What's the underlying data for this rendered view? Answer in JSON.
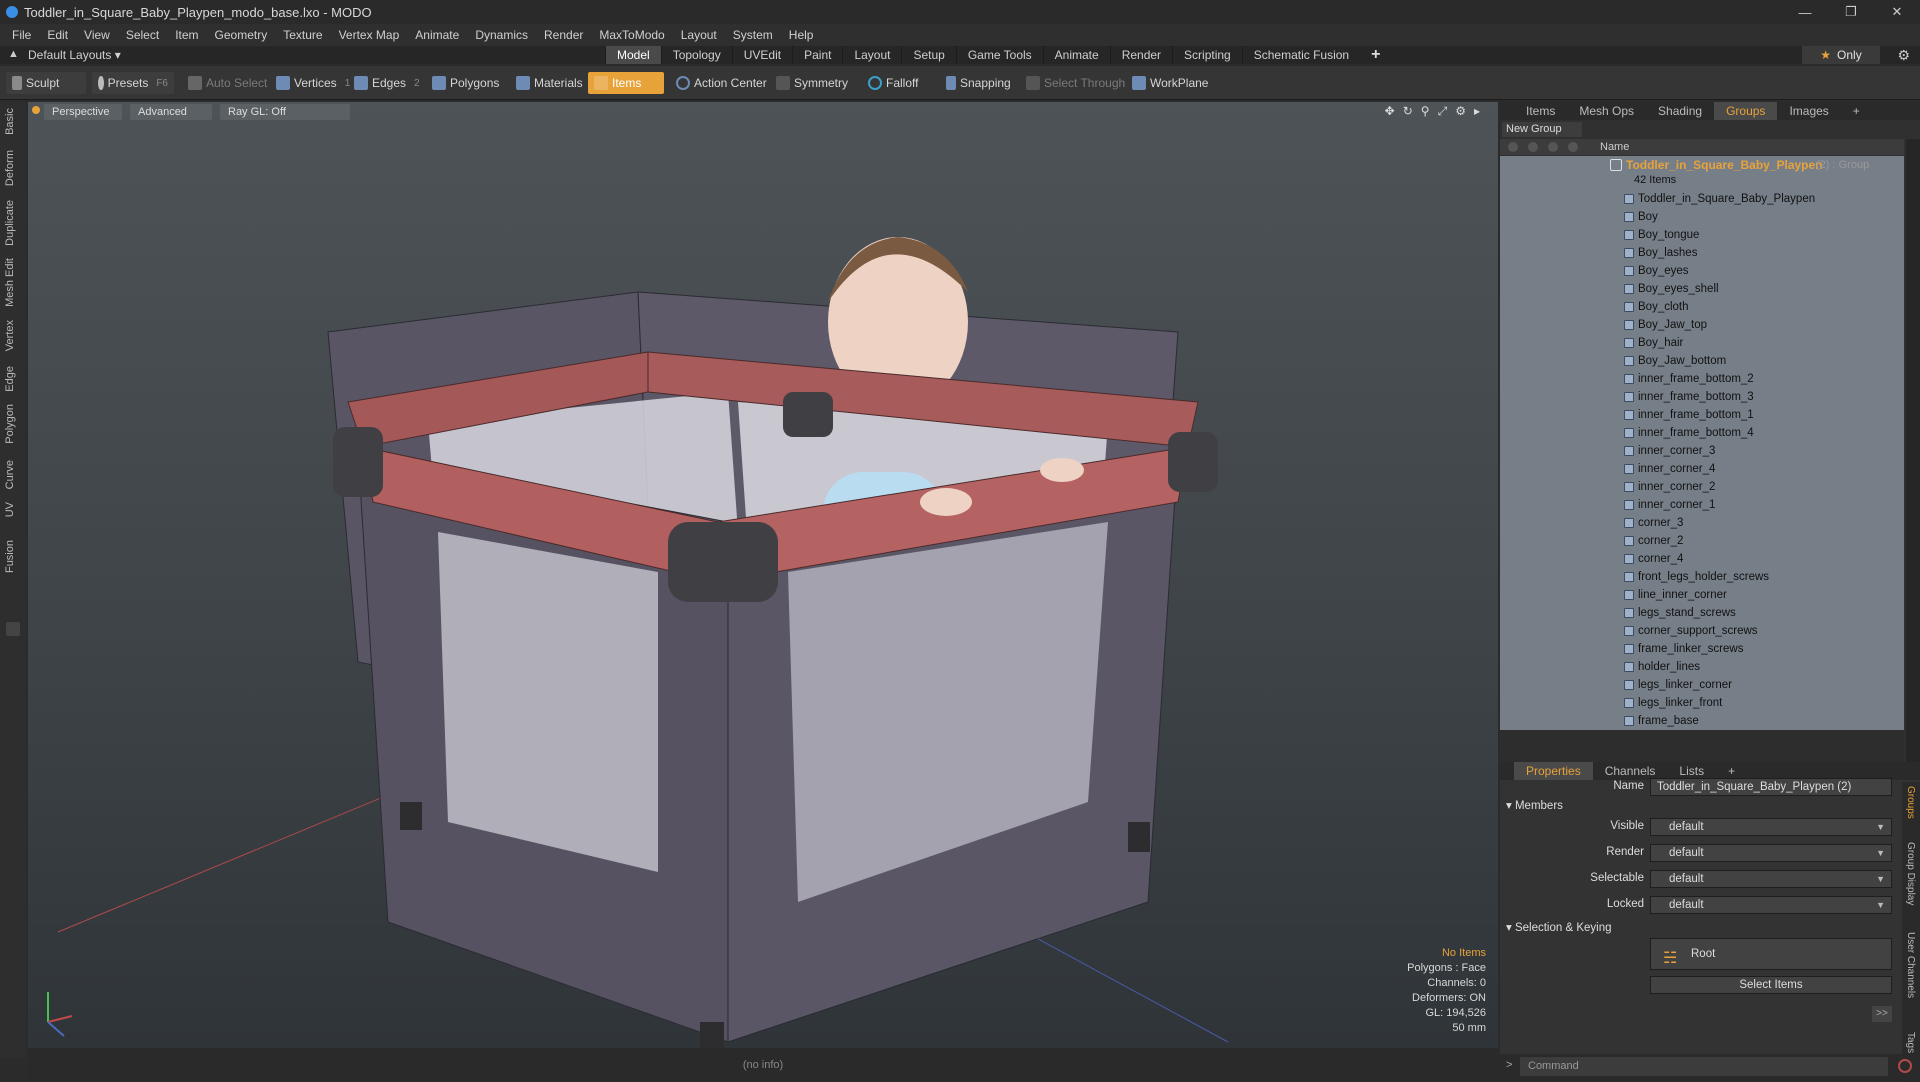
{
  "window": {
    "title": "Toddler_in_Square_Baby_Playpen_modo_base.lxo - MODO"
  },
  "menu": [
    "File",
    "Edit",
    "View",
    "Select",
    "Item",
    "Geometry",
    "Texture",
    "Vertex Map",
    "Animate",
    "Dynamics",
    "Render",
    "MaxToModo",
    "Layout",
    "System",
    "Help"
  ],
  "layout": {
    "dropdown": "Default Layouts ▾",
    "tabs": [
      "Model",
      "Topology",
      "UVEdit",
      "Paint",
      "Layout",
      "Setup",
      "Game Tools",
      "Animate",
      "Render",
      "Scripting",
      "Schematic Fusion"
    ],
    "active_tab": "Model",
    "only_label": "Only"
  },
  "toolbar": {
    "sculpt": "Sculpt",
    "presets": "Presets",
    "presets_key": "F6",
    "auto_select": "Auto Select",
    "vertices": "Vertices",
    "vertices_count": "1",
    "edges": "Edges",
    "edges_count": "2",
    "polygons": "Polygons",
    "materials": "Materials",
    "items": "Items",
    "action_center": "Action Center",
    "symmetry": "Symmetry",
    "falloff": "Falloff",
    "snapping": "Snapping",
    "select_through": "Select Through",
    "workplane": "WorkPlane"
  },
  "left_tabs": [
    "Basic",
    "Deform",
    "Duplicate",
    "Mesh Edit",
    "Vertex",
    "Edge",
    "Polygon",
    "Curve",
    "UV",
    "Fusion"
  ],
  "viewport": {
    "perspective": "Perspective",
    "advanced": "Advanced",
    "raygl": "Ray GL: Off",
    "info": {
      "no_items": "No Items",
      "polygons": "Polygons : Face",
      "channels": "Channels: 0",
      "deformers": "Deformers: ON",
      "gl": "GL: 194,526",
      "lens": "50 mm"
    },
    "status": "(no info)"
  },
  "panel_top": {
    "tabs": [
      "Items",
      "Mesh Ops",
      "Shading",
      "Groups",
      "Images"
    ],
    "active": "Groups",
    "new_group": "New Group",
    "name_header": "Name",
    "group": {
      "title": "Toddler_in_Square_Baby_Playpen",
      "suffix": "(2) : Group",
      "count": "42 Items"
    },
    "items": [
      "Toddler_in_Square_Baby_Playpen",
      "Boy",
      "Boy_tongue",
      "Boy_lashes",
      "Boy_eyes",
      "Boy_eyes_shell",
      "Boy_cloth",
      "Boy_Jaw_top",
      "Boy_hair",
      "Boy_Jaw_bottom",
      "inner_frame_bottom_2",
      "inner_frame_bottom_3",
      "inner_frame_bottom_1",
      "inner_frame_bottom_4",
      "inner_corner_3",
      "inner_corner_4",
      "inner_corner_2",
      "inner_corner_1",
      "corner_3",
      "corner_2",
      "corner_4",
      "front_legs_holder_screws",
      "line_inner_corner",
      "legs_stand_screws",
      "corner_support_screws",
      "frame_linker_screws",
      "holder_lines",
      "legs_linker_corner",
      "legs_linker_front",
      "frame_base"
    ]
  },
  "panel_props": {
    "tabs": [
      "Properties",
      "Channels",
      "Lists"
    ],
    "active": "Properties",
    "name_label": "Name",
    "name_value": "Toddler_in_Square_Baby_Playpen (2)",
    "members": "Members",
    "visible_label": "Visible",
    "render_label": "Render",
    "selectable_label": "Selectable",
    "locked_label": "Locked",
    "default_value": "default",
    "selection_keying": "Selection & Keying",
    "root": "Root",
    "select_items": "Select Items",
    "side_tabs": [
      "Groups",
      "Group Display",
      "User Channels",
      "Tags"
    ]
  },
  "command": {
    "placeholder": "Command"
  },
  "colors": {
    "accent": "#e8a23a",
    "selection": "#767f88"
  }
}
